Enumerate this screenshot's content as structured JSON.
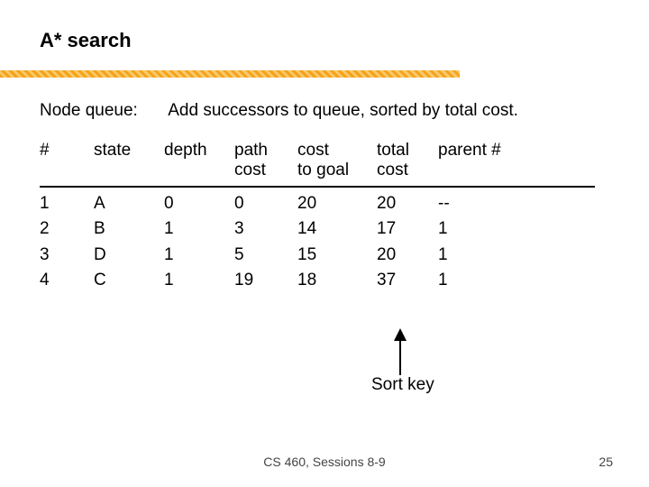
{
  "title": "A* search",
  "subhead": {
    "label": "Node queue:",
    "action": "Add successors to queue, sorted by total cost."
  },
  "table": {
    "headers": {
      "num": "#",
      "state": "state",
      "depth": "depth",
      "path_cost": "path\ncost",
      "cost_to_goal": "cost\nto goal",
      "total_cost": "total\ncost",
      "parent": "parent #"
    },
    "rows": [
      {
        "num": "1",
        "state": "A",
        "depth": "0",
        "path_cost": "0",
        "cost_to_goal": "20",
        "total_cost": "20",
        "parent": "--"
      },
      {
        "num": "2",
        "state": "B",
        "depth": "1",
        "path_cost": "3",
        "cost_to_goal": "14",
        "total_cost": "17",
        "parent": "1"
      },
      {
        "num": "3",
        "state": "D",
        "depth": "1",
        "path_cost": "5",
        "cost_to_goal": "15",
        "total_cost": "20",
        "parent": "1"
      },
      {
        "num": "4",
        "state": "C",
        "depth": "1",
        "path_cost": "19",
        "cost_to_goal": "18",
        "total_cost": "37",
        "parent": "1"
      }
    ]
  },
  "sort_key_label": "Sort key",
  "footer": "CS 460,  Sessions 8-9",
  "page_number": "25",
  "chart_data": {
    "type": "table",
    "title": "A* search node queue",
    "columns": [
      "#",
      "state",
      "depth",
      "path cost",
      "cost to goal",
      "total cost",
      "parent #"
    ],
    "rows": [
      [
        1,
        "A",
        0,
        0,
        20,
        20,
        "--"
      ],
      [
        2,
        "B",
        1,
        3,
        14,
        17,
        1
      ],
      [
        3,
        "D",
        1,
        5,
        15,
        20,
        1
      ],
      [
        4,
        "C",
        1,
        19,
        18,
        37,
        1
      ]
    ],
    "sort_key_column": "total cost"
  }
}
